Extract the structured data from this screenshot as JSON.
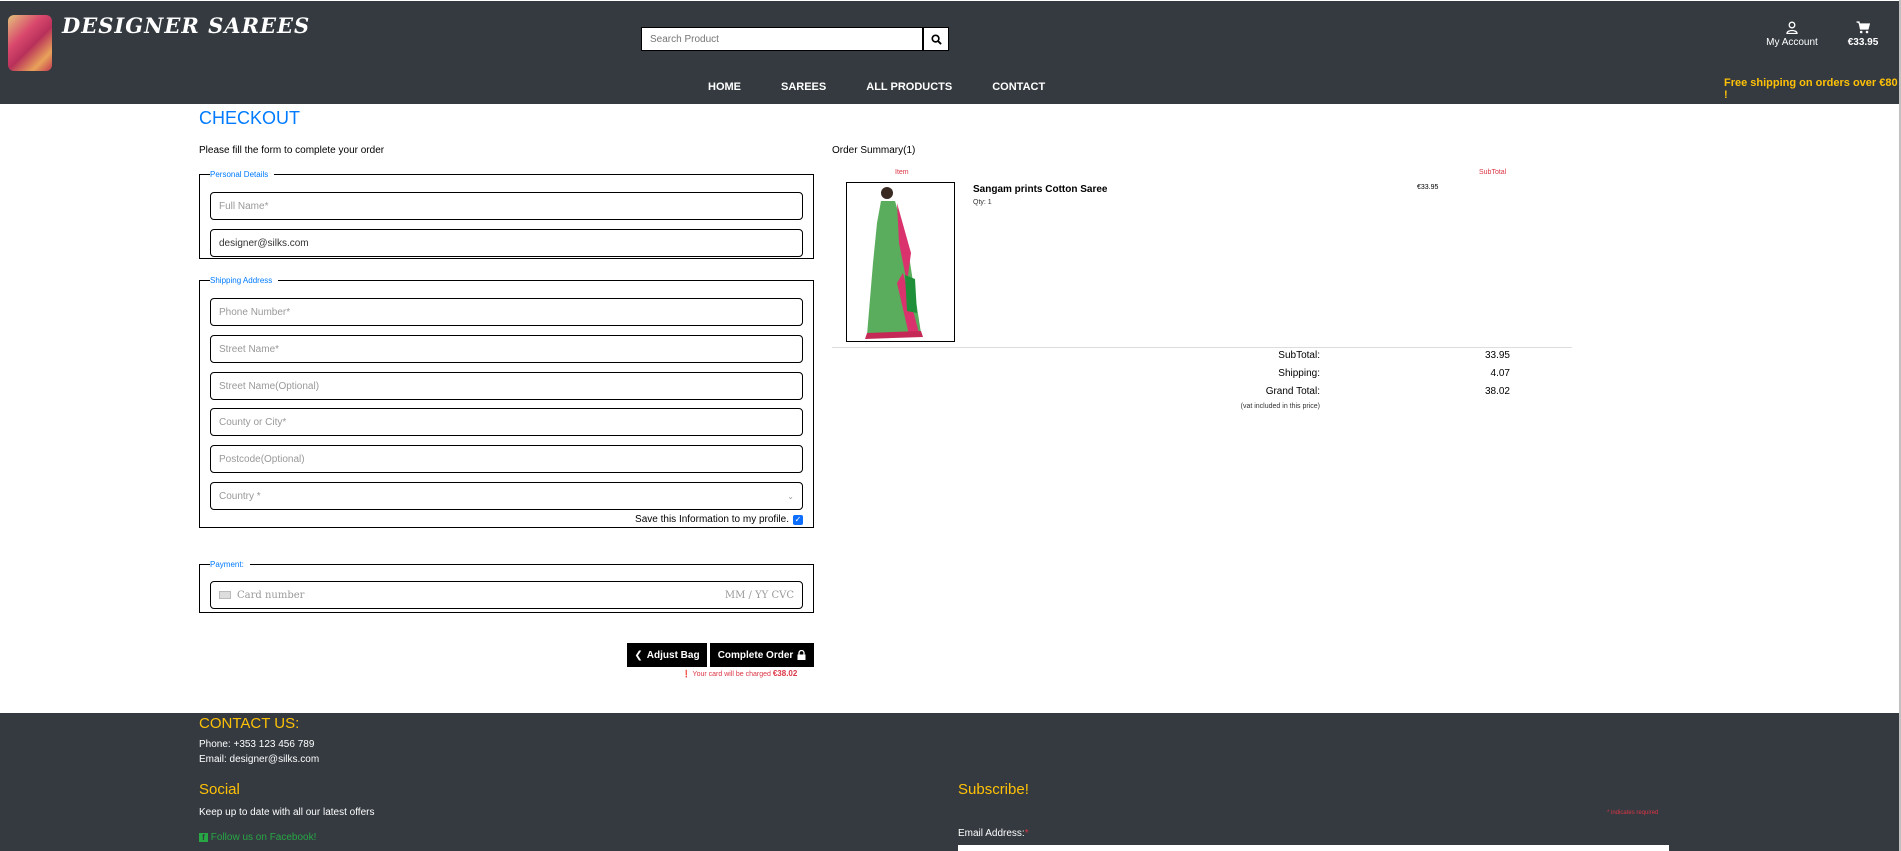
{
  "header": {
    "brand": "DESIGNER SAREES",
    "search_placeholder": "Search Product",
    "nav": [
      "HOME",
      "SAREES",
      "ALL PRODUCTS",
      "CONTACT"
    ],
    "account_label": "My Account",
    "bag_total": "€33.95",
    "free_shipping": "Free shipping on orders over €80 !"
  },
  "checkout": {
    "title": "CHECKOUT",
    "subtitle": "Please fill the form to complete your order",
    "personal_legend": "Personal Details",
    "full_name_placeholder": "Full Name*",
    "email_value": "designer@silks.com",
    "shipping_legend": "Shipping Address",
    "phone_placeholder": "Phone Number*",
    "street1_placeholder": "Street Name*",
    "street2_placeholder": "Street Name(Optional)",
    "county_placeholder": "County or City*",
    "postcode_placeholder": "Postcode(Optional)",
    "country_placeholder": "Country *",
    "save_label": "Save this Information to my profile.",
    "save_checked": true,
    "payment_legend": "Payment:",
    "card_placeholder": "Card number",
    "card_expiry_cvc": "MM / YY  CVC",
    "adjust_bag": "Adjust Bag",
    "complete_order": "Complete Order",
    "charge_text": "Your card will be charged",
    "charge_amount": "€38.02"
  },
  "summary": {
    "title": "Order Summary(1)",
    "col_item": "Item",
    "col_subtotal": "SubTotal",
    "product_name": "Sangam prints Cotton Saree",
    "product_qty": "Qty: 1",
    "product_price": "€33.95",
    "subtotal_label": "SubTotal:",
    "subtotal_value": "33.95",
    "shipping_label": "Shipping:",
    "shipping_value": "4.07",
    "grand_label": "Grand Total:",
    "grand_value": "38.02",
    "vat_note": "(vat included in this price)"
  },
  "footer": {
    "contact_heading": "CONTACT US:",
    "phone": "Phone: +353 123 456 789",
    "email": "Email: designer@silks.com",
    "social_heading": "Social",
    "social_text": "Keep up to date with all our latest offers",
    "facebook": "Follow us on Facebook!",
    "subscribe_heading": "Subscribe!",
    "required_note": "indicates required",
    "email_label": "Email Address:"
  },
  "colors": {
    "header_bg": "#343a40",
    "accent_blue": "#007bff",
    "accent_yellow": "#ffc107",
    "danger": "#dc3545"
  },
  "icons": [
    "search-icon",
    "user-icon",
    "cart-icon",
    "chevron-left-icon",
    "lock-icon",
    "alert-icon",
    "facebook-icon",
    "card-icon",
    "chevron-down-icon"
  ]
}
